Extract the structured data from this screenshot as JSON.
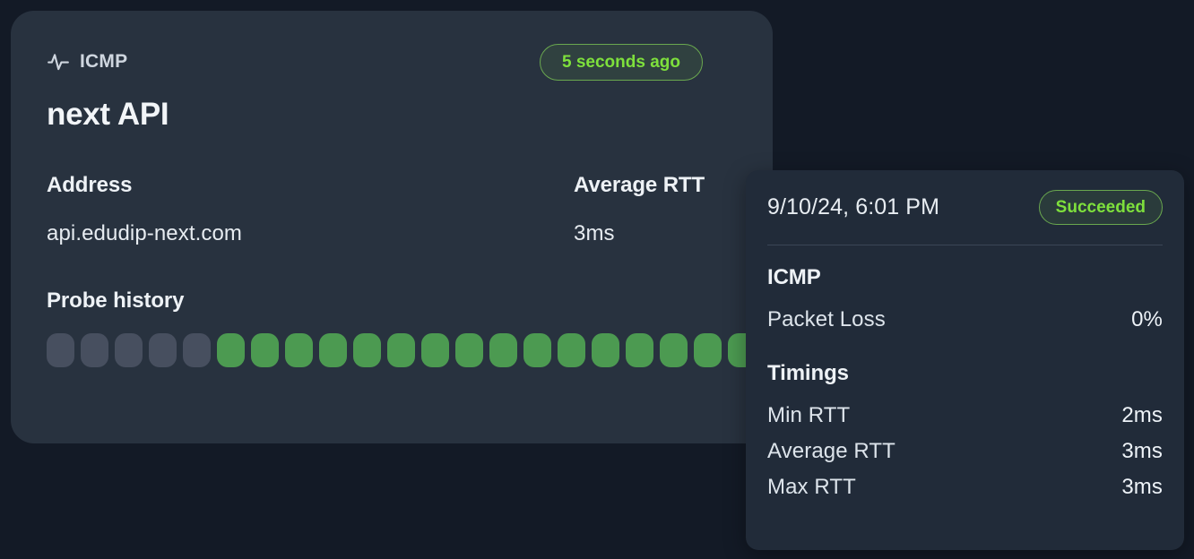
{
  "monitor": {
    "protocol_icon": "pulse-activity-icon",
    "protocol_label": "ICMP",
    "freshness": "5 seconds ago",
    "title": "next API",
    "metrics": [
      {
        "label": "Address",
        "value": "api.edudip-next.com"
      },
      {
        "label": "Average RTT",
        "value": "3ms"
      }
    ],
    "probe_history": {
      "heading": "Probe history",
      "colors": {
        "empty": "#474f5f",
        "success": "#4c9a51"
      },
      "bars": [
        "empty",
        "empty",
        "empty",
        "empty",
        "empty",
        "success",
        "success",
        "success",
        "success",
        "success",
        "success",
        "success",
        "success",
        "success",
        "success",
        "success",
        "success",
        "success",
        "success",
        "success",
        "success",
        "success",
        "success",
        "success"
      ]
    }
  },
  "tooltip": {
    "timestamp": "9/10/24, 6:01 PM",
    "status": "Succeeded",
    "groups": [
      {
        "title": "ICMP",
        "rows": [
          {
            "key": "Packet Loss",
            "value": "0%"
          }
        ]
      },
      {
        "title": "Timings",
        "rows": [
          {
            "key": "Min RTT",
            "value": "2ms"
          },
          {
            "key": "Average RTT",
            "value": "3ms"
          },
          {
            "key": "Max RTT",
            "value": "3ms"
          }
        ]
      }
    ]
  },
  "theme": {
    "page_bg": "#131a26",
    "card_bg": "#28323f",
    "tooltip_bg": "#212b39",
    "accent_green": "#7ee03c",
    "border_green": "#6aa84f"
  }
}
